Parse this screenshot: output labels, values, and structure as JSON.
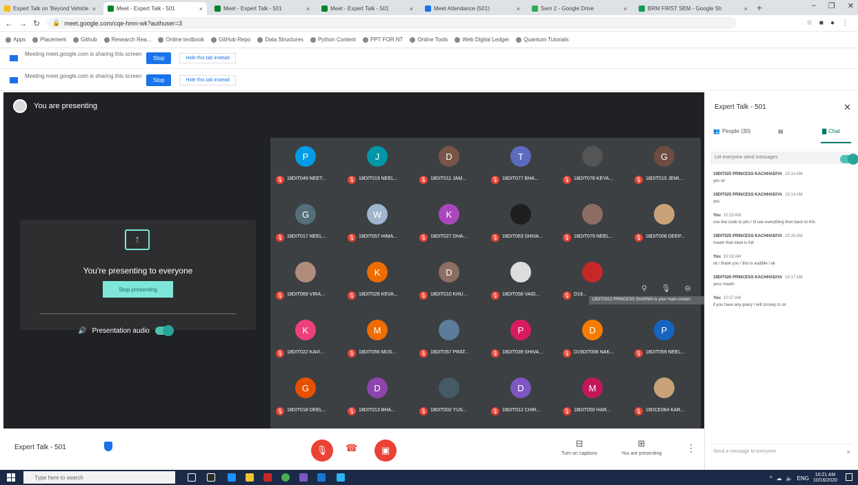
{
  "browser": {
    "tabs": [
      {
        "label": "Expert Talk on 'Beyond Vehicle",
        "color": "#fbbc04",
        "active": false
      },
      {
        "label": "Meet - Expert Talk - 501",
        "color": "#00832d",
        "active": true
      },
      {
        "label": "Meet - Expert Talk - 501",
        "color": "#00832d",
        "active": false
      },
      {
        "label": "Meet - Expert Talk - 501",
        "color": "#00832d",
        "active": false
      },
      {
        "label": "Meet Attendance (501)",
        "color": "#1a73e8",
        "active": false
      },
      {
        "label": "Sem 2 - Google Drive",
        "color": "#34a853",
        "active": false
      },
      {
        "label": "BRM FIRST SEM - Google Sh",
        "color": "#0f9d58",
        "active": false
      }
    ],
    "new_tab": "+",
    "url": "meet.google.com/cqe-hmn-wk?authuser=3",
    "bookmarks": [
      "Apps",
      "Placement",
      "Github",
      "Research Rea...",
      "Online textbook",
      "GitHub Repo",
      "Data Structures",
      "Python Content",
      "PPT FOR NT",
      "Online Tools",
      "Web Digital Ledger",
      "Quantum Tutorials"
    ]
  },
  "share_bars": [
    {
      "message": "Meeting meet.google.com is sharing this screen",
      "stop_label": "Stop",
      "hide_label": "Hide this tab instead"
    },
    {
      "message": "Meeting meet.google.com is sharing this screen",
      "stop_label": "Stop",
      "hide_label": "Hide this tab instead"
    }
  ],
  "meet": {
    "presenting_header": "You are presenting",
    "presenting_card_title": "You're presenting to everyone",
    "stop_presenting_label": "Stop presenting",
    "presentation_audio_label": "Presentation audio",
    "tooltip": "19DIT0013 PRINCESS SHARMA is your main screen",
    "participants": [
      {
        "initial": "P",
        "color": "#039be5",
        "name": "18DIT049 NEET..."
      },
      {
        "initial": "J",
        "color": "#0097a7",
        "name": "18DIT019 NEEL..."
      },
      {
        "initial": "D",
        "color": "#795548",
        "name": "18DIT011 JAM..."
      },
      {
        "initial": "T",
        "color": "#5c6bc0",
        "name": "18DIT077 BHA..."
      },
      {
        "initial": "",
        "color": "#555555",
        "name": "18DIT078 KEYA..."
      },
      {
        "initial": "G",
        "color": "#6d4c41",
        "name": "18DIT015 JEMI..."
      },
      {
        "initial": "G",
        "color": "#546e7a",
        "name": "18DIT017 NEEL..."
      },
      {
        "initial": "W",
        "color": "#9fb6cd",
        "name": "18DIT057 HIMA..."
      },
      {
        "initial": "K",
        "color": "#ab47bc",
        "name": "18DIT027 DHA..."
      },
      {
        "initial": "",
        "color": "#1f1f1f",
        "name": "18DIT063 SHIVA..."
      },
      {
        "initial": "",
        "color": "#8d6e63",
        "name": "18DIT079 NEEL..."
      },
      {
        "initial": "",
        "color": "#c9a27a",
        "name": "18DIT008 DEEP..."
      },
      {
        "initial": "",
        "color": "#b08c7a",
        "name": "18DIT069 VIRA..."
      },
      {
        "initial": "K",
        "color": "#ef6c00",
        "name": "18DIT028 KEVA..."
      },
      {
        "initial": "D",
        "color": "#8d6e63",
        "name": "18DIT010 KHU..."
      },
      {
        "initial": "",
        "color": "#dddddd",
        "name": "18DIT058 VAID..."
      },
      {
        "initial": "",
        "color": "#c62828",
        "name": "D19..."
      },
      {
        "initial": "",
        "color": "#3c4043",
        "name": ""
      },
      {
        "initial": "K",
        "color": "#ec407a",
        "name": "18DIT022 KAVI..."
      },
      {
        "initial": "M",
        "color": "#ef6c00",
        "name": "18DIT056 MUS..."
      },
      {
        "initial": "",
        "color": "#5d7b9c",
        "name": "18DIT057 PRAT..."
      },
      {
        "initial": "P",
        "color": "#d81b60",
        "name": "18DIT039 SHIVA..."
      },
      {
        "initial": "D",
        "color": "#f57c00",
        "name": "D19DIT006 NAK..."
      },
      {
        "initial": "P",
        "color": "#1565c0",
        "name": "18DIT059 NEEL..."
      },
      {
        "initial": "G",
        "color": "#e65100",
        "name": "18DIT018 DEEL..."
      },
      {
        "initial": "D",
        "color": "#8e44ad",
        "name": "18DIT013 BHA..."
      },
      {
        "initial": "",
        "color": "#455a64",
        "name": "18DIT002 YUS..."
      },
      {
        "initial": "D",
        "color": "#7e57c2",
        "name": "18DIT012 CHIR..."
      },
      {
        "initial": "M",
        "color": "#c2185b",
        "name": "18DIT050 HAR..."
      },
      {
        "initial": "",
        "color": "#c9a27a",
        "name": "19DCE064 KAR..."
      }
    ],
    "bottom": {
      "meeting_name": "Expert Talk - 501",
      "captions_label": "Turn on captions",
      "presenting_label": "You are presenting"
    }
  },
  "chat": {
    "title": "Expert Talk - 501",
    "people_tab": "People (30)",
    "chat_tab": "Chat",
    "everyone_label": "Let everyone send messages",
    "messages": [
      {
        "sender": "19DIT025 PRINCESS KACHHADIYA",
        "time": "10:14 AM",
        "text": "yes sir"
      },
      {
        "sender": "19DIT025 PRINCESS KACHHADIYA",
        "time": "10:14 AM",
        "text": "yes"
      },
      {
        "sender": "You",
        "time": "10:15 AM",
        "text": "use live code to join / Ill see everything then back to this"
      },
      {
        "sender": "19DIT025 PRINCESS KACHHADIYA",
        "time": "10:16 AM",
        "text": "maam that meet is full"
      },
      {
        "sender": "You",
        "time": "10:18 AM",
        "text": "ok / thank you / this is audible / ok"
      },
      {
        "sender": "19DIT026 PRINCESS KACHHADIYA",
        "time": "10:17 AM",
        "text": "yess maam"
      },
      {
        "sender": "You",
        "time": "10:17 AM",
        "text": "if you have any query I will convey to sir"
      }
    ],
    "input_placeholder": "Send a message to everyone"
  },
  "taskbar": {
    "search_placeholder": "Type here to search",
    "time": "10:21 AM",
    "date": "10/16/2020",
    "lang": "ENG"
  }
}
